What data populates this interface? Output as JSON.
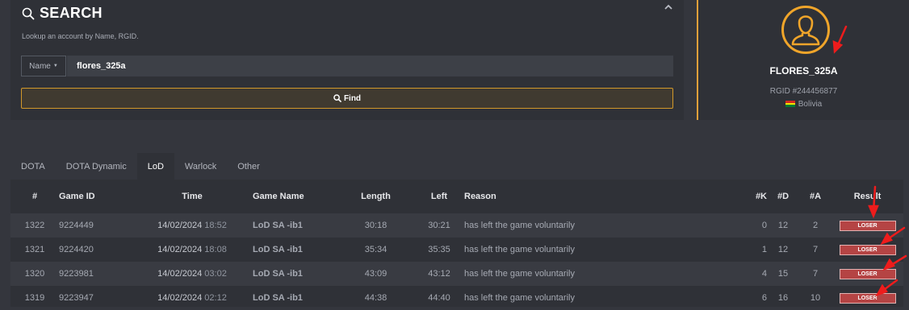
{
  "search": {
    "title": "SEARCH",
    "subtitle": "Lookup an account by Name, RGID.",
    "filter_label": "Name",
    "query": "flores_325a",
    "find_label": "Find"
  },
  "profile": {
    "name": "FLORES_325A",
    "rgid": "RGID #244456877",
    "country": "Bolivia"
  },
  "tabs": [
    "DOTA",
    "DOTA Dynamic",
    "LoD",
    "Warlock",
    "Other"
  ],
  "active_tab": "LoD",
  "table": {
    "headers": [
      "#",
      "Game ID",
      "Time",
      "Game Name",
      "Length",
      "Left",
      "Reason",
      "#K",
      "#D",
      "#A",
      "Result"
    ],
    "rows": [
      {
        "num": "1322",
        "game_id": "9224449",
        "date": "14/02/2024",
        "clock": "18:52",
        "game_name": "LoD SA -ib1",
        "length": "30:18",
        "left": "30:21",
        "reason": "has left the game voluntarily",
        "k": "0",
        "d": "12",
        "a": "2",
        "result": "LOSER"
      },
      {
        "num": "1321",
        "game_id": "9224420",
        "date": "14/02/2024",
        "clock": "18:08",
        "game_name": "LoD SA -ib1",
        "length": "35:34",
        "left": "35:35",
        "reason": "has left the game voluntarily",
        "k": "1",
        "d": "12",
        "a": "7",
        "result": "LOSER"
      },
      {
        "num": "1320",
        "game_id": "9223981",
        "date": "14/02/2024",
        "clock": "03:02",
        "game_name": "LoD SA -ib1",
        "length": "43:09",
        "left": "43:12",
        "reason": "has left the game voluntarily",
        "k": "4",
        "d": "15",
        "a": "7",
        "result": "LOSER"
      },
      {
        "num": "1319",
        "game_id": "9223947",
        "date": "14/02/2024",
        "clock": "02:12",
        "game_name": "LoD SA -ib1",
        "length": "44:38",
        "left": "44:40",
        "reason": "has left the game voluntarily",
        "k": "6",
        "d": "16",
        "a": "10",
        "result": "LOSER"
      }
    ]
  },
  "colors": {
    "accent": "#f0a52a",
    "loser": "#b54444",
    "panel": "#2f3137",
    "background": "#34363d",
    "annotation": "#ee1c1c"
  },
  "icons": [
    "search-icon",
    "chevron-up-icon",
    "caret-down-icon",
    "user-avatar-icon",
    "bolivia-flag-icon"
  ]
}
